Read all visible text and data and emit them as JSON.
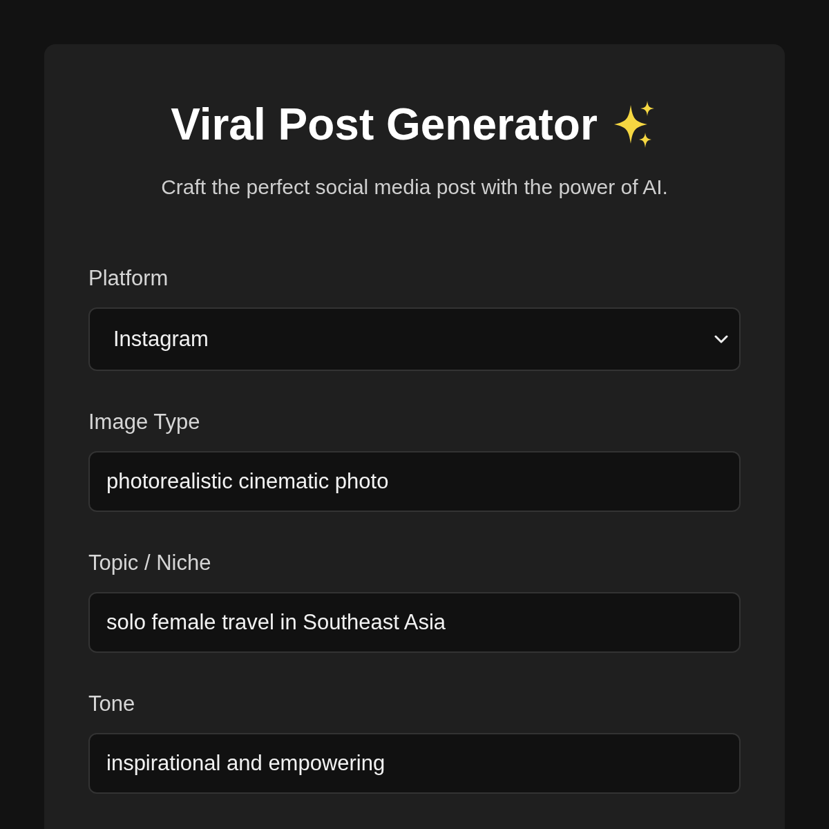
{
  "header": {
    "title": "Viral Post Generator",
    "subtitle": "Craft the perfect social media post with the power of AI."
  },
  "fields": [
    {
      "kind": "select",
      "label": "Platform",
      "value": "Instagram"
    },
    {
      "kind": "input",
      "label": "Image Type",
      "value": "photorealistic cinematic photo"
    },
    {
      "kind": "input",
      "label": "Topic / Niche",
      "value": "solo female travel in Southeast Asia"
    },
    {
      "kind": "input",
      "label": "Tone",
      "value": "inspirational and empowering"
    }
  ]
}
